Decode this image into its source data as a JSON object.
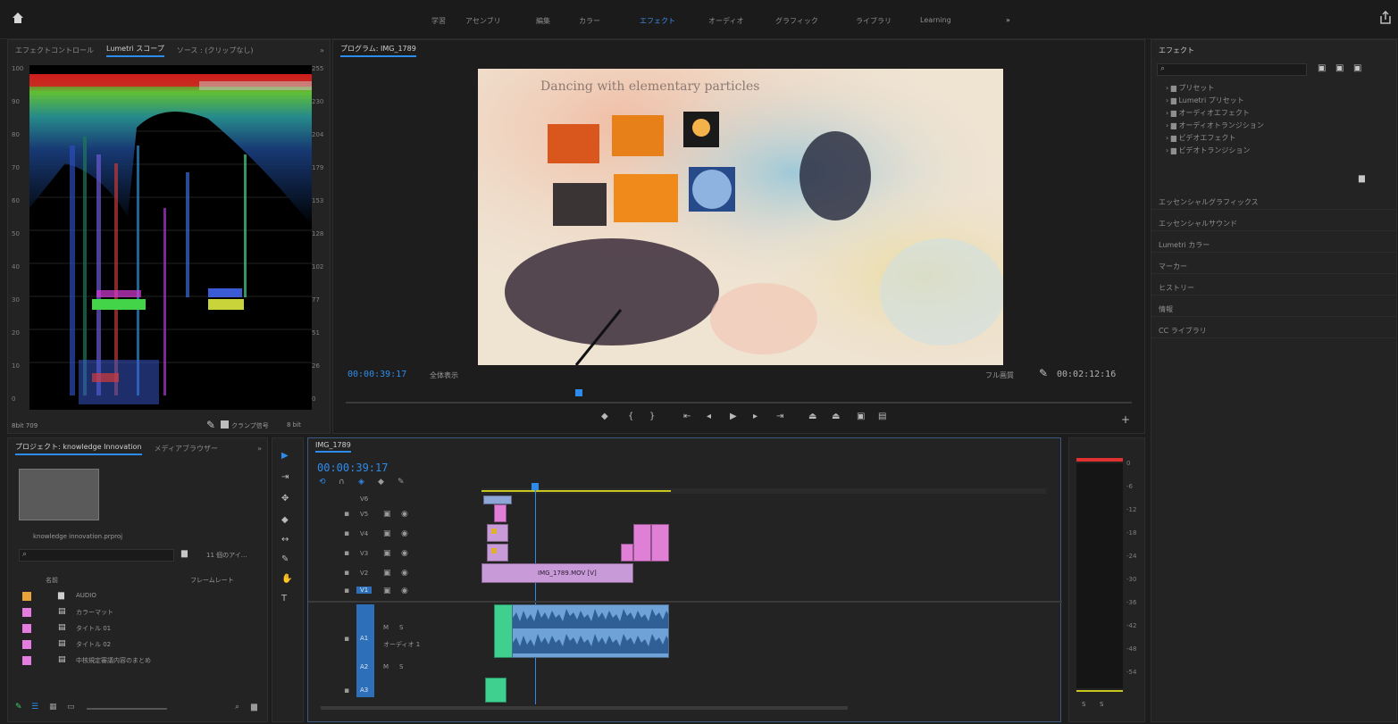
{
  "topbar": {
    "home_icon": "home-icon",
    "workspaces": [
      "学習",
      "アセンブリ",
      "編集",
      "カラー",
      "エフェクト",
      "オーディオ",
      "グラフィック",
      "ライブラリ",
      "Learning"
    ],
    "active_workspace": "エフェクト",
    "more_label": "»",
    "share_icon": "share-icon"
  },
  "scope_panel": {
    "tabs": [
      "エフェクトコントロール",
      "Lumetri スコープ",
      "ソース : (クリップなし)"
    ],
    "left_ticks": [
      "100",
      "90",
      "80",
      "70",
      "60",
      "50",
      "40",
      "30",
      "20",
      "10",
      "0"
    ],
    "right_ticks": [
      "255",
      "230",
      "204",
      "179",
      "153",
      "128",
      "102",
      "77",
      "51",
      "26",
      "0"
    ],
    "bottom_left": "8bit  709",
    "clamp_label": "クランプ信号",
    "bits_label": "8 bit"
  },
  "program_monitor": {
    "tab": "プログラム: IMG_1789",
    "timecode": "00:00:39:17",
    "fit_label": "全体表示",
    "quality_label": "フル画質",
    "duration": "00:02:12:16",
    "video_title": "Dancing with elementary particles"
  },
  "project_panel": {
    "tabs": [
      "プロジェクト: knowledge Innovation",
      "メディアブラウザー"
    ],
    "project_file": "knowledge innovation.prproj",
    "item_count": "11 個のアイ...",
    "col_name": "名前",
    "col_framerate": "フレームレート",
    "items": [
      {
        "label": "AUDIO",
        "color": "#e8a33a",
        "icon": "folder-icon"
      },
      {
        "label": "カラーマット",
        "color": "#e57ce0",
        "icon": "file-icon"
      },
      {
        "label": "タイトル 01",
        "color": "#e57ce0",
        "icon": "file-icon"
      },
      {
        "label": "タイトル 02",
        "color": "#e57ce0",
        "icon": "file-icon"
      },
      {
        "label": "中核規定審議内容のまとめ",
        "color": "#e57ce0",
        "icon": "file-icon"
      }
    ]
  },
  "timeline": {
    "tab": "IMG_1789",
    "timecode": "00:00:39:17",
    "video_tracks": [
      "V6",
      "V5",
      "V4",
      "V3",
      "V2",
      "V1"
    ],
    "audio_tracks": [
      "A1",
      "A2",
      "A3"
    ],
    "audio_track_name": "オーディオ 1",
    "v1_clip_label": "IMG_1789.MOV [V]"
  },
  "effects_panel": {
    "title": "エフェクト",
    "search_placeholder": "",
    "tree": [
      "プリセット",
      "Lumetri プリセット",
      "オーディオエフェクト",
      "オーディオトランジション",
      "ビデオエフェクト",
      "ビデオトランジション"
    ],
    "sections": [
      "エッセンシャルグラフィックス",
      "エッセンシャルサウンド",
      "Lumetri カラー",
      "マーカー",
      "ヒストリー",
      "情報",
      "CC ライブラリ"
    ]
  },
  "audio_meter": {
    "scale": [
      "0",
      "-6",
      "-12",
      "-18",
      "-24",
      "-30",
      "-36",
      "-42",
      "-48",
      "-54"
    ],
    "buttons": [
      "S",
      "S"
    ]
  }
}
